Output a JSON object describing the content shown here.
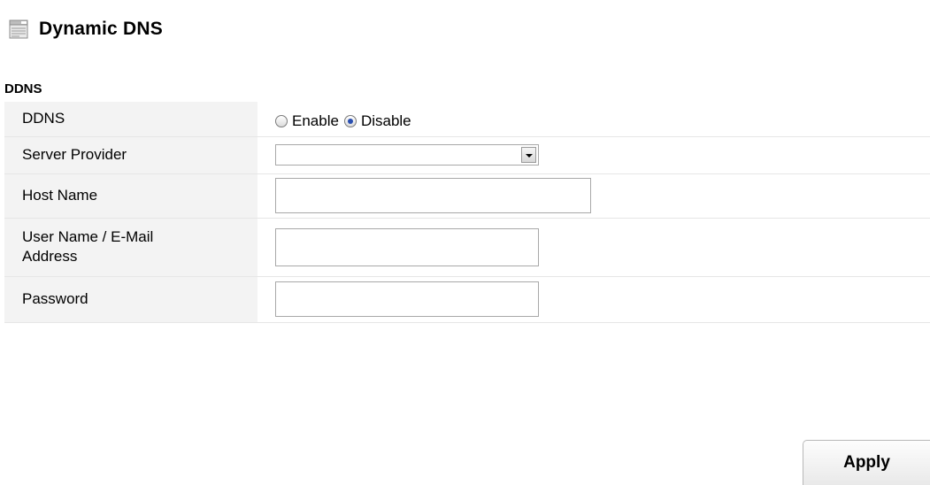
{
  "header": {
    "title": "Dynamic DNS",
    "icon": "server-icon"
  },
  "section": {
    "label": "DDNS"
  },
  "form": {
    "ddns": {
      "label": "DDNS",
      "options": [
        "Enable",
        "Disable"
      ],
      "selected": "Disable"
    },
    "server_provider": {
      "label": "Server Provider",
      "value": ""
    },
    "host_name": {
      "label": "Host Name",
      "value": ""
    },
    "user_name": {
      "label_line1": "User Name / E-Mail",
      "label_line2": "Address",
      "value": ""
    },
    "password": {
      "label": "Password",
      "value": ""
    }
  },
  "actions": {
    "apply_label": "Apply"
  },
  "colors": {
    "label_bg": "#f3f3f3",
    "row_border": "#e6e6e6",
    "radio_dot": "#2a4fb0"
  }
}
